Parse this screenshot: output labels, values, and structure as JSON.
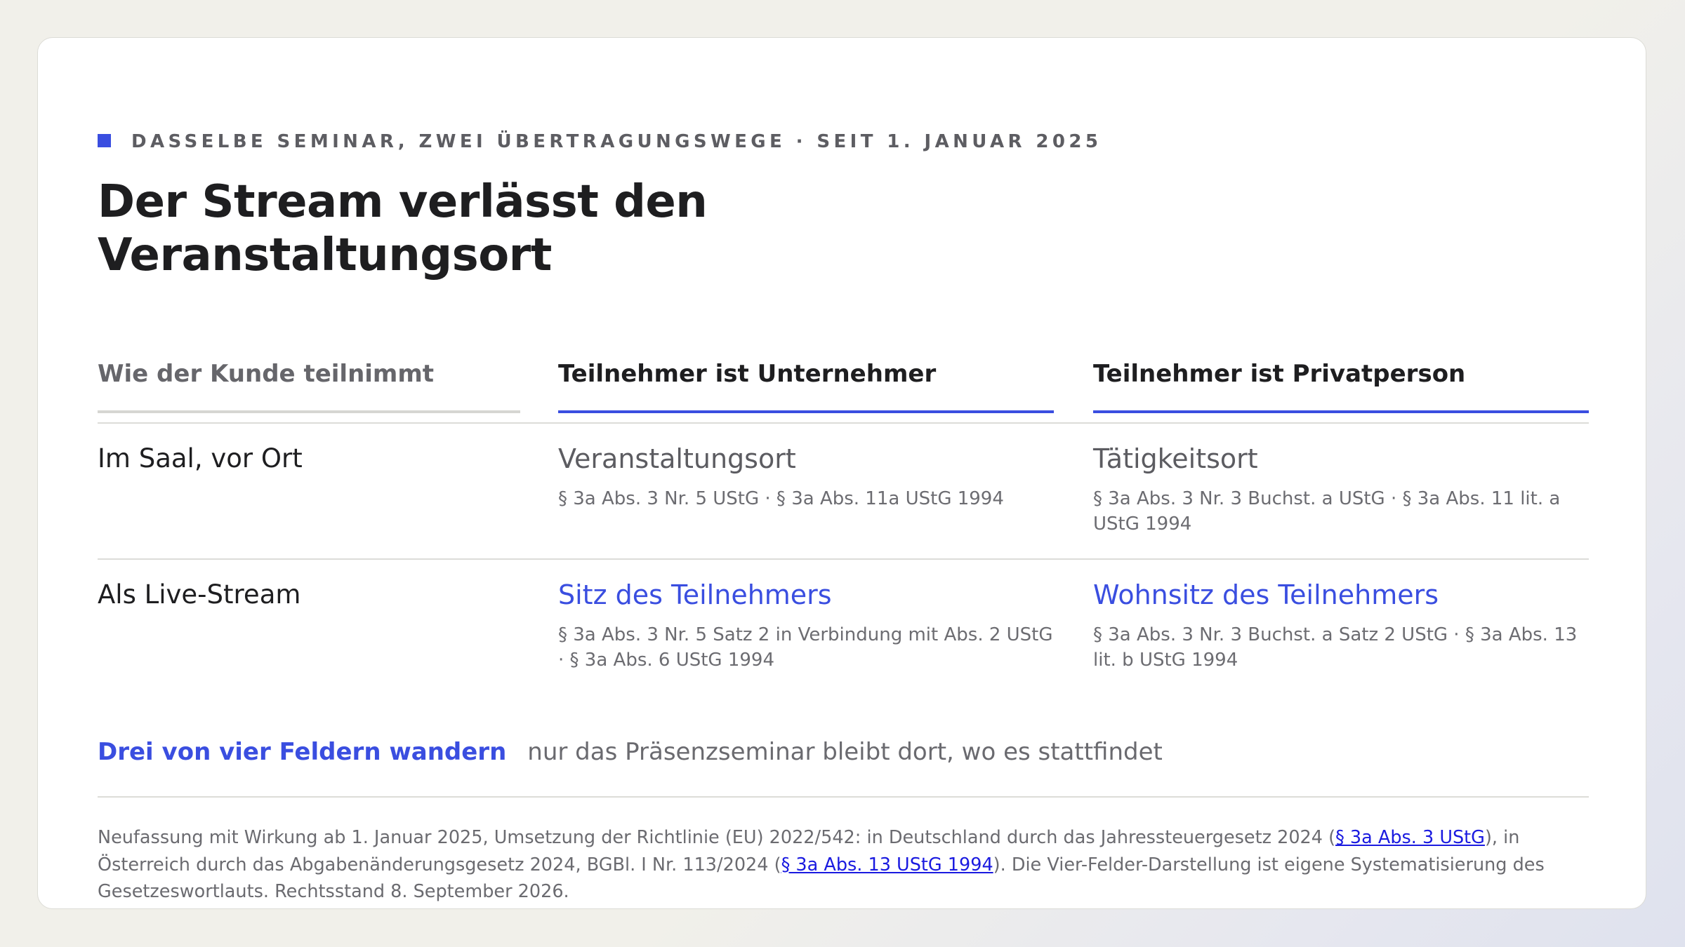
{
  "eyebrow": "DASSELBE SEMINAR, ZWEI ÜBERTRAGUNGSWEGE · SEIT 1. JANUAR 2025",
  "title_line1": "Der Stream verlässt den",
  "title_line2": "Veranstaltungsort",
  "table": {
    "headers": [
      "Wie der Kunde teilnimmt",
      "Teilnehmer ist Unternehmer",
      "Teilnehmer ist Privatperson"
    ],
    "rows": [
      {
        "label": "Im Saal, vor Ort",
        "business_main": "Veranstaltungsort",
        "business_ref": "§ 3a Abs. 3 Nr. 5 UStG · § 3a Abs. 11a UStG 1994",
        "private_main": "Tätigkeitsort",
        "private_ref": "§ 3a Abs. 3 Nr. 3 Buchst. a UStG · § 3a Abs. 11 lit. a UStG 1994"
      },
      {
        "label": "Als Live-Stream",
        "business_main": "Sitz des Teilnehmers",
        "business_ref": "§ 3a Abs. 3 Nr. 5 Satz 2 in Verbindung mit Abs. 2 UStG · § 3a Abs. 6 UStG 1994",
        "private_main": "Wohnsitz des Teilnehmers",
        "private_ref": "§ 3a Abs. 3 Nr. 3 Buchst. a Satz 2 UStG · § 3a Abs. 13 lit. b UStG 1994"
      }
    ]
  },
  "summary": {
    "strong": "Drei von vier Feldern wandern",
    "rest": "nur das Präsenzseminar bleibt dort, wo es stattfindet"
  },
  "footnote": {
    "part1": "Neufassung mit Wirkung ab 1. Januar 2025, Umsetzung der Richtlinie (EU) 2022/542: in Deutschland durch das Jahressteuergesetz 2024 (",
    "link1": "§ 3a Abs. 3 UStG",
    "part2": "), in Österreich durch das Abgabenänderungsgesetz 2024, BGBl. I Nr. 113/2024 (",
    "link2": "§ 3a Abs. 13 UStG 1994",
    "part3": "). Die Vier-Felder-Darstellung ist eigene Systematisierung des Gesetzeswortlauts. Rechtsstand 8. September 2026."
  },
  "colors": {
    "accent": "#3a4ee0",
    "link": "#1a1ae0"
  }
}
